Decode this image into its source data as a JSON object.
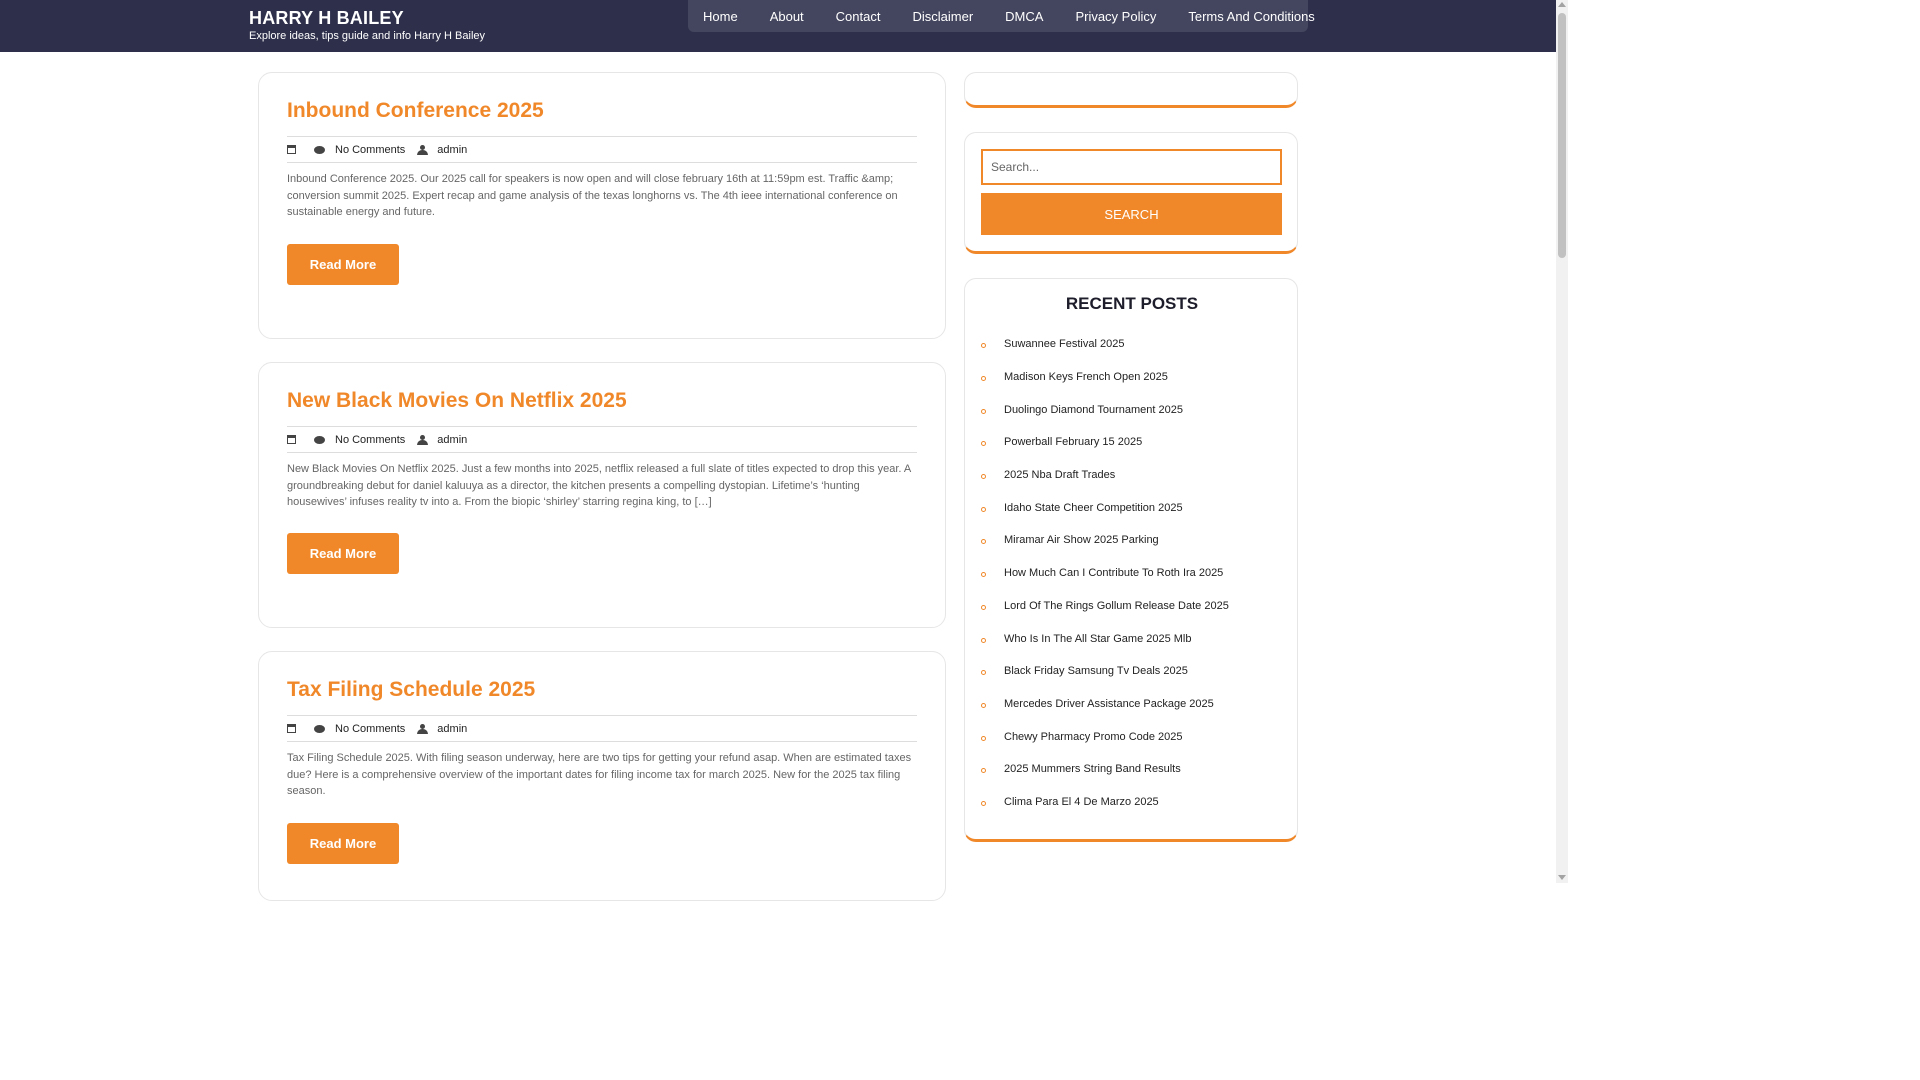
{
  "header": {
    "site_title": "HARRY H BAILEY",
    "tagline": "Explore ideas, tips guide and info Harry H Bailey"
  },
  "nav": {
    "items": [
      "Home",
      "About",
      "Contact",
      "Disclaimer",
      "DMCA",
      "Privacy Policy",
      "Terms And Conditions"
    ]
  },
  "posts": [
    {
      "title": "Inbound Conference 2025",
      "comments": "No Comments",
      "author": "admin",
      "excerpt": "Inbound Conference 2025. Our 2025 call for speakers is now open and will close february 16th at 11:59pm est. Traffic &amp; conversion summit 2025. Expert recap and game analysis of the texas longhorns vs. The 4th ieee international conference on sustainable energy and future.",
      "read_more": "Read More"
    },
    {
      "title": "New Black Movies On Netflix 2025",
      "comments": "No Comments",
      "author": "admin",
      "excerpt": "New Black Movies On Netflix 2025. Just a few months into 2025, netflix released a full slate of titles expected to drop this year. A groundbreaking debut for daniel kaluuya as a director, the kitchen presents a compelling dystopian. Lifetime’s ‘hunting housewives’ infuses reality tv into a. From the biopic ‘shirley’ starring regina king, to […]",
      "read_more": "Read More"
    },
    {
      "title": "Tax Filing Schedule 2025",
      "comments": "No Comments",
      "author": "admin",
      "excerpt": "Tax Filing Schedule 2025. With filing season underway, here are two tips for getting your refund asap. When are estimated taxes due? Here is a comprehensive overview of the important dates for filing income tax for march 2025. New for the 2025 tax filing season.",
      "read_more": "Read More"
    }
  ],
  "sidebar": {
    "search": {
      "placeholder": "Search...",
      "button_label": "SEARCH"
    },
    "recent_posts": {
      "title": "RECENT POSTS",
      "items": [
        "Suwannee Festival 2025",
        "Madison Keys French Open 2025",
        "Duolingo Diamond Tournament 2025",
        "Powerball February 15 2025",
        "2025 Nba Draft Trades",
        "Idaho State Cheer Competition 2025",
        "Miramar Air Show 2025 Parking",
        "How Much Can I Contribute To Roth Ira 2025",
        "Lord Of The Rings Gollum Release Date 2025",
        "Who Is In The All Star Game 2025 Mlb",
        "Black Friday Samsung Tv Deals 2025",
        "Mercedes Driver Assistance Package 2025",
        "Chewy Pharmacy Promo Code 2025",
        "2025 Mummers String Band Results",
        "Clima Para El 4 De Marzo 2025"
      ]
    }
  },
  "colors": {
    "header_bg": "#2e2f4b",
    "nav_bg": "#44465f",
    "accent": "#f0882a"
  }
}
